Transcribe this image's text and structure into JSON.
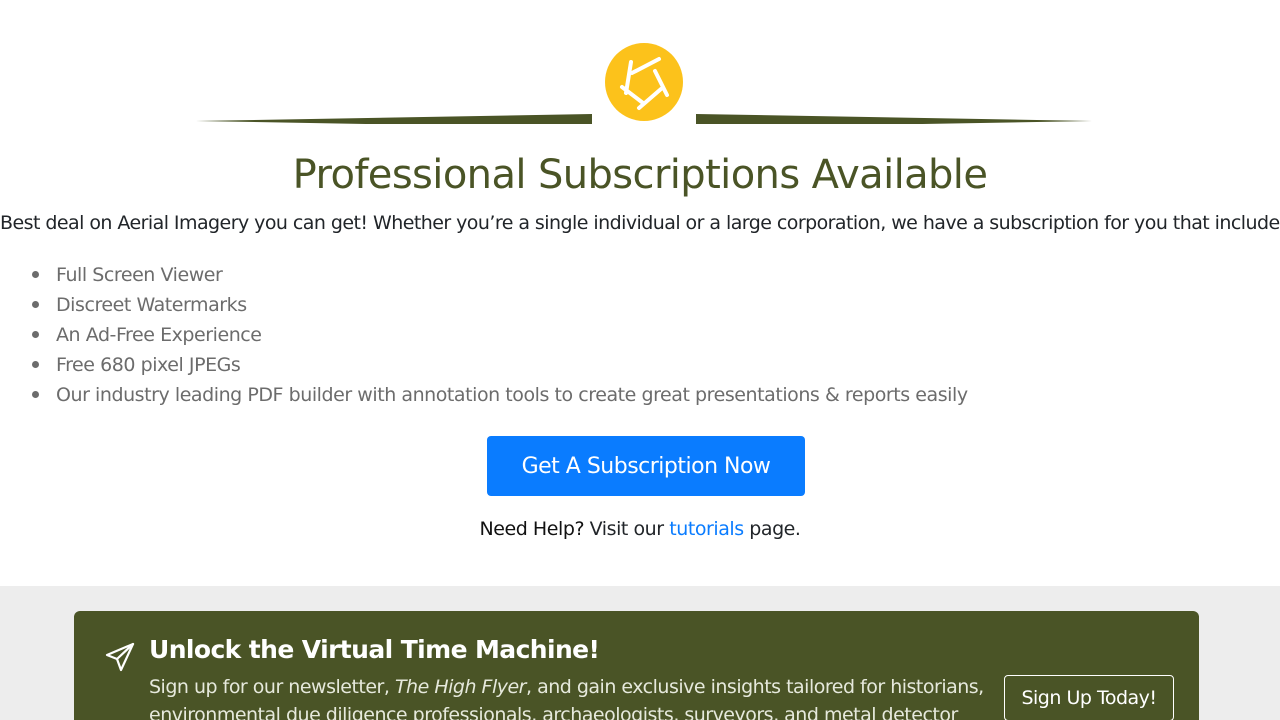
{
  "brand": {
    "accent_olive": "#4a5426",
    "shutter_yellow": "#fcc21b",
    "primary_blue": "#0a7cff",
    "logo_icon": "camera-shutter-icon"
  },
  "subscriptions": {
    "title": "Professional Subscriptions Available",
    "intro": "Best deal on Aerial Imagery you can get! Whether you’re a single individual or a large corporation, we have a subscription for you that includes:",
    "features": [
      "Full Screen Viewer",
      "Discreet Watermarks",
      "An Ad-Free Experience",
      "Free 680 pixel JPEGs",
      "Our industry leading PDF builder with annotation tools to create great presentations & reports easily"
    ],
    "cta_label": "Get A Subscription Now"
  },
  "help": {
    "strong": "Need Help?",
    "prefix": "Visit our",
    "link": "tutorials",
    "suffix": "page."
  },
  "newsletter": {
    "icon": "paper-plane-icon",
    "heading": "Unlock the Virtual Time Machine!",
    "text_prefix": "Sign up for our newsletter,",
    "text_italic": "The High Flyer",
    "text_suffix": ", and gain exclusive insights tailored for historians, environmental due diligence professionals, archaeologists, surveyors, and metal detector",
    "button_label": "Sign Up Today!"
  }
}
